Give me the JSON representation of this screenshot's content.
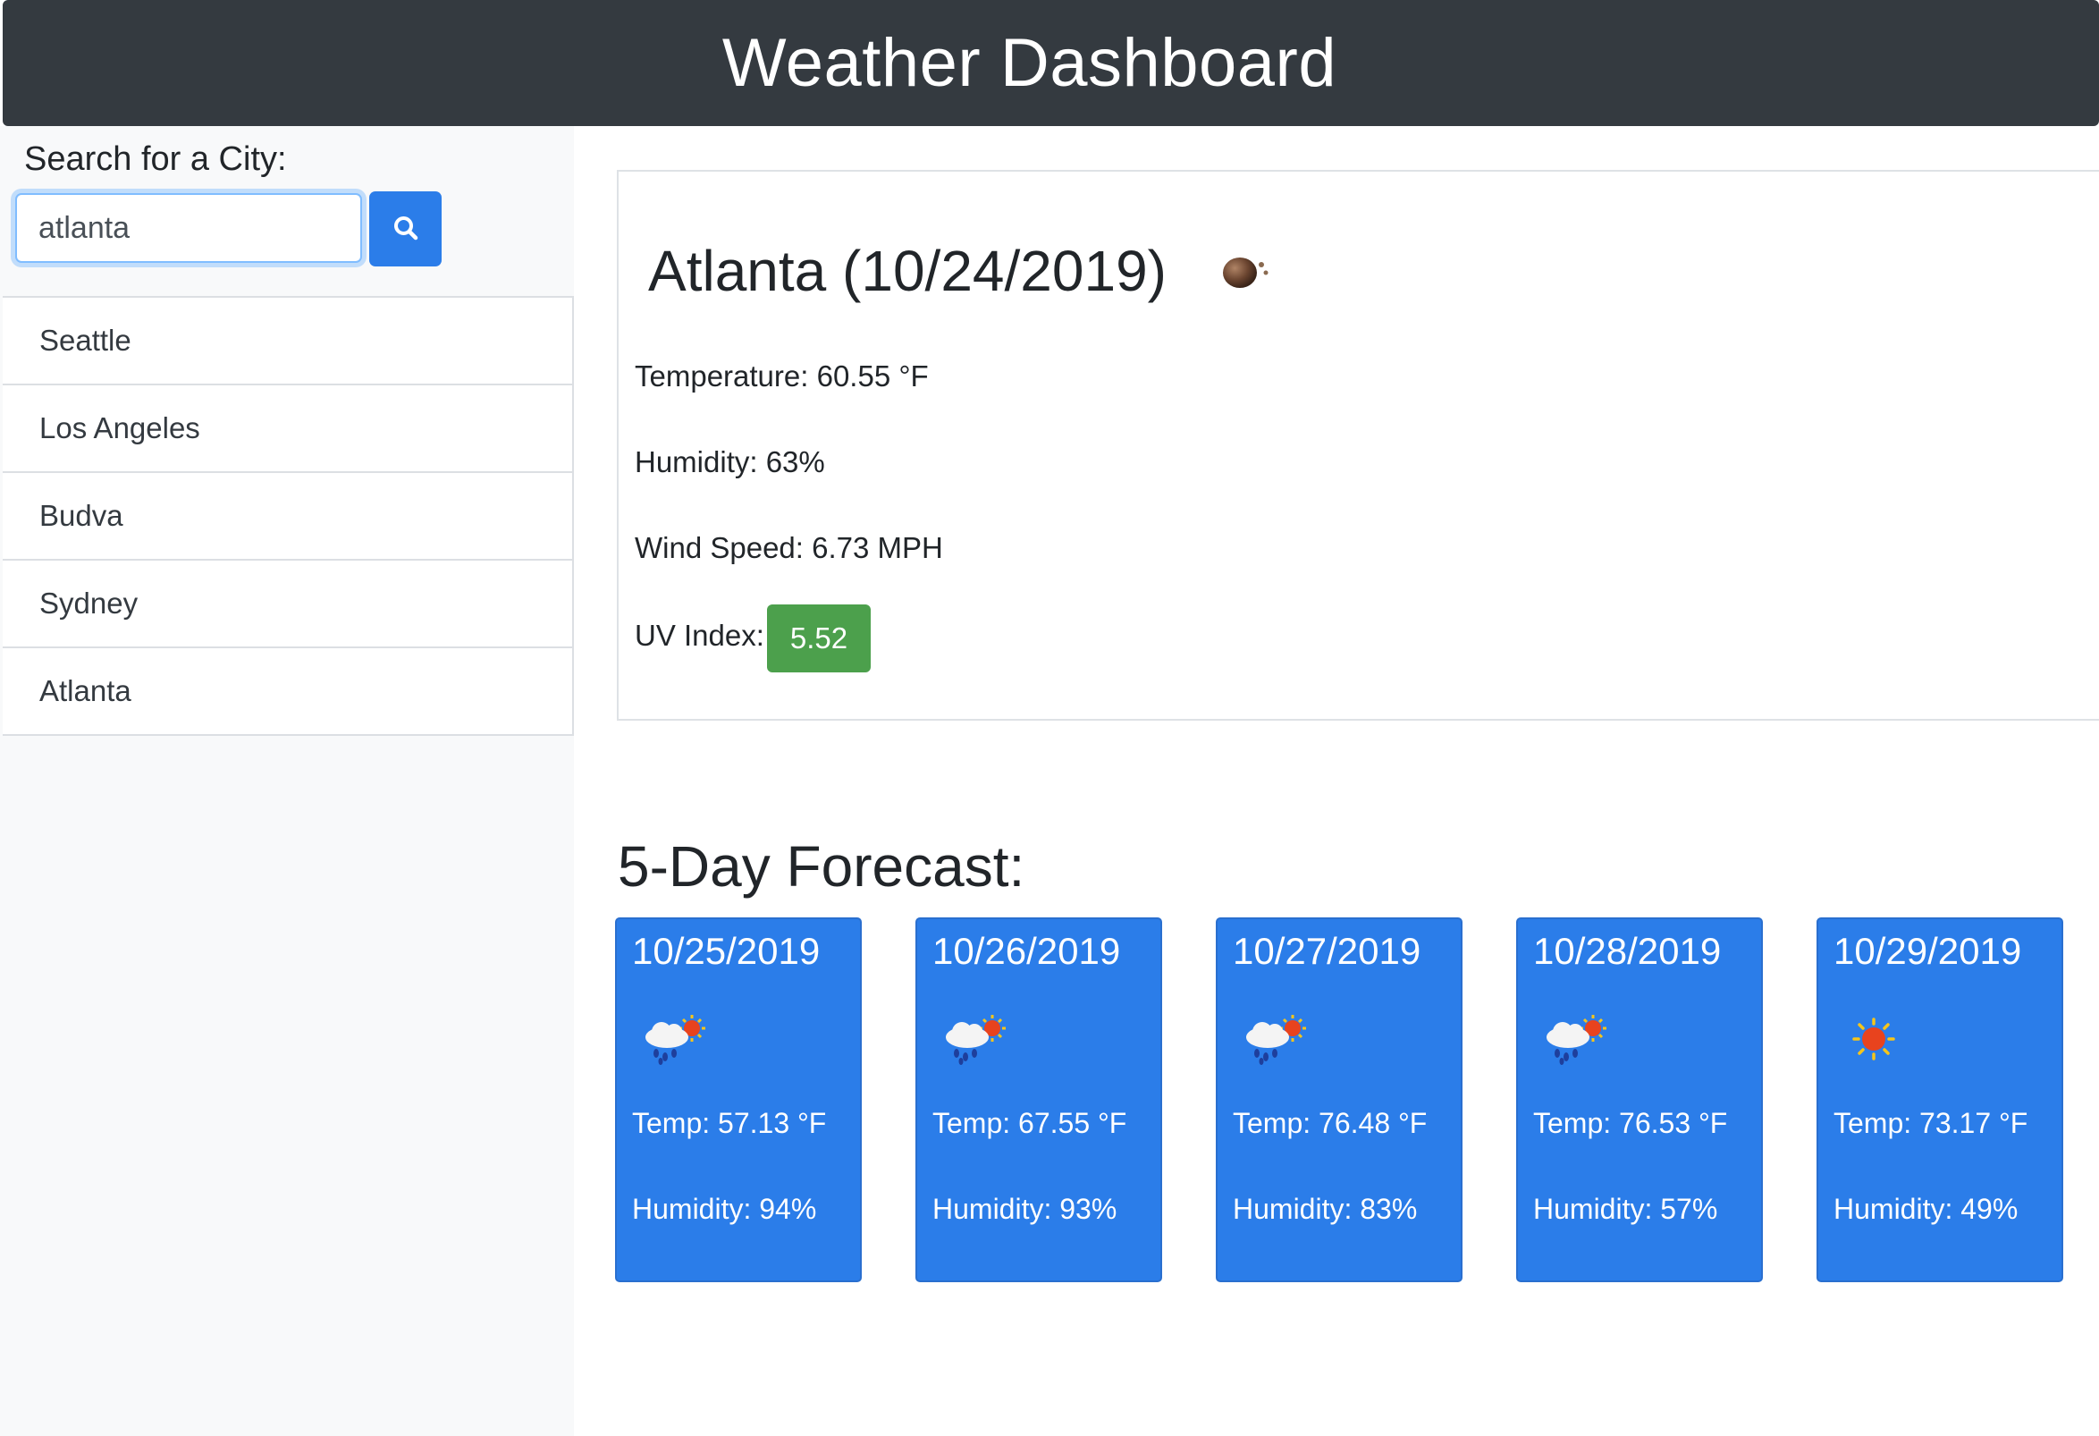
{
  "header": {
    "title": "Weather Dashboard"
  },
  "search": {
    "label": "Search for a City:",
    "value": "atlanta",
    "button_icon": "search-icon"
  },
  "cities": [
    "Seattle",
    "Los Angeles",
    "Budva",
    "Sydney",
    "Atlanta"
  ],
  "current": {
    "title": "Atlanta (10/24/2019)",
    "icon": "mist-icon",
    "temperature": "Temperature: 60.55 °F",
    "humidity": "Humidity: 63%",
    "wind": "Wind Speed: 6.73 MPH",
    "uv_label": "UV Index:",
    "uv_value": "5.52",
    "uv_color": "#4ca04c"
  },
  "forecast": {
    "title": "5-Day Forecast:",
    "days": [
      {
        "date": "10/25/2019",
        "icon": "rain-sun-icon",
        "temp": "Temp: 57.13 °F",
        "humidity": "Humidity: 94%"
      },
      {
        "date": "10/26/2019",
        "icon": "rain-sun-icon",
        "temp": "Temp: 67.55 °F",
        "humidity": "Humidity: 93%"
      },
      {
        "date": "10/27/2019",
        "icon": "rain-sun-icon",
        "temp": "Temp: 76.48 °F",
        "humidity": "Humidity: 83%"
      },
      {
        "date": "10/28/2019",
        "icon": "rain-sun-icon",
        "temp": "Temp: 76.53 °F",
        "humidity": "Humidity: 57%"
      },
      {
        "date": "10/29/2019",
        "icon": "sun-icon",
        "temp": "Temp: 73.17 °F",
        "humidity": "Humidity: 49%"
      }
    ]
  },
  "colors": {
    "header_bg": "#343a40",
    "accent": "#2b7de9",
    "sidebar_bg": "#f8f9fa"
  }
}
